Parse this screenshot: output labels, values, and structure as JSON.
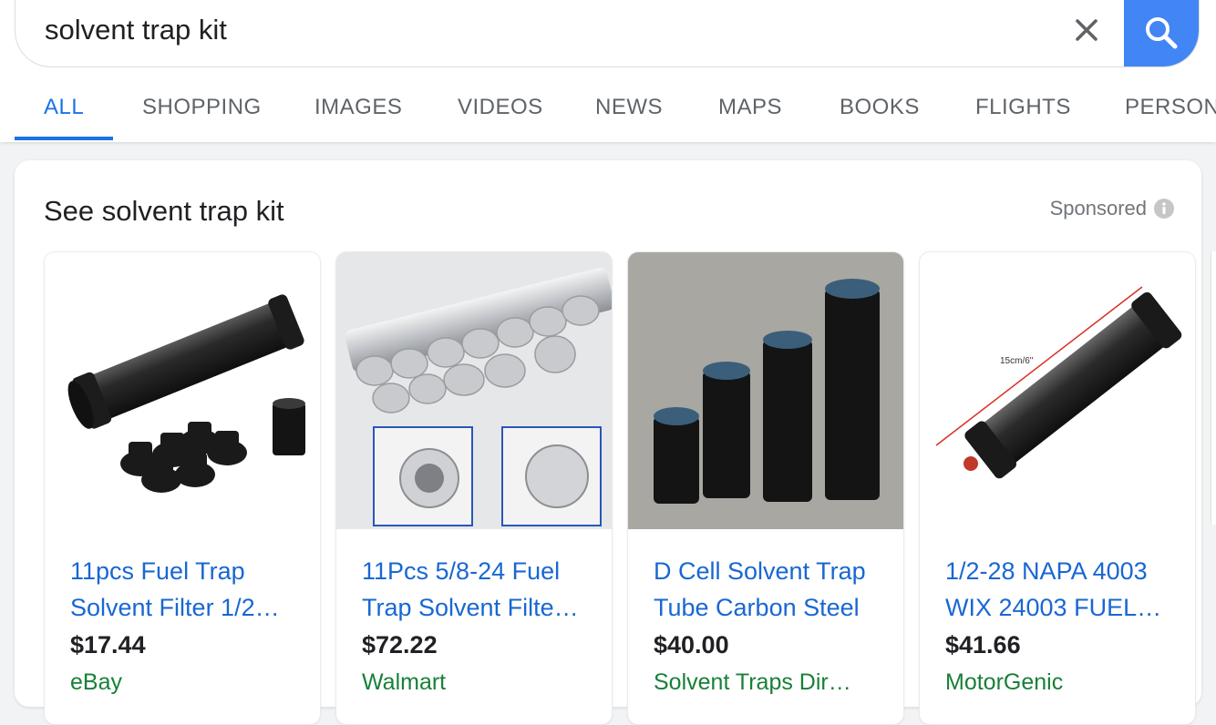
{
  "search": {
    "query": "solvent trap kit",
    "clear_icon": "close-icon",
    "search_icon": "search-icon",
    "accent": "#4285f4"
  },
  "tabs": [
    {
      "label": "ALL",
      "active": true
    },
    {
      "label": "SHOPPING"
    },
    {
      "label": "IMAGES"
    },
    {
      "label": "VIDEOS"
    },
    {
      "label": "NEWS"
    },
    {
      "label": "MAPS"
    },
    {
      "label": "BOOKS"
    },
    {
      "label": "FLIGHTS"
    },
    {
      "label": "PERSON"
    }
  ],
  "shopping": {
    "title": "See solvent trap kit",
    "sponsored": "Sponsored",
    "products": [
      {
        "title": "11pcs Fuel Trap\nSolvent Filter 1/2…",
        "price": "$17.44",
        "merchant": "eBay"
      },
      {
        "title": "11Pcs 5/8-24 Fuel\nTrap Solvent Filte…",
        "price": "$72.22",
        "merchant": "Walmart"
      },
      {
        "title": "D Cell Solvent Trap\nTube Carbon Steel",
        "price": "$40.00",
        "merchant": "Solvent Traps Dir…"
      },
      {
        "title": "1/2-28 NAPA 4003\nWIX 24003 FUEL…",
        "price": "$41.66",
        "merchant": "MotorGenic"
      }
    ],
    "image_3_label": "15cm/6\""
  },
  "colors": {
    "link": "#1967d2",
    "merchant": "#188038",
    "tab_active": "#1a73e8",
    "tab_inactive": "#5f6368"
  }
}
